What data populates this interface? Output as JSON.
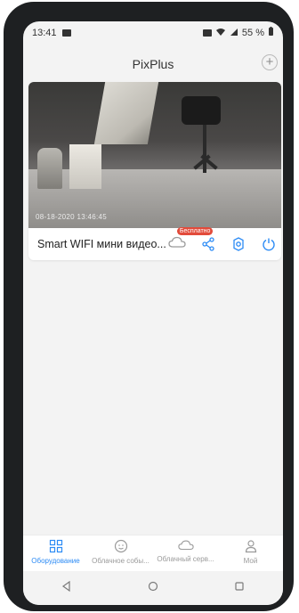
{
  "status_bar": {
    "time": "13:41",
    "battery": "55 %",
    "icons": [
      "video-camera-icon",
      "nfc-icon",
      "wifi-icon",
      "signal-icon",
      "battery-icon"
    ]
  },
  "header": {
    "title": "PixPlus",
    "add_label": "+"
  },
  "device_card": {
    "camera_timestamp": "08-18-2020 13:46:45",
    "device_name": "Smart WIFI мини видео...",
    "cloud_badge": "Бесплатно",
    "action_icons": [
      "cloud-icon",
      "share-icon",
      "settings-icon",
      "power-icon"
    ]
  },
  "bottom_nav": {
    "items": [
      {
        "label": "Оборудование",
        "icon": "grid-icon",
        "active": true
      },
      {
        "label": "Облачное собы...",
        "icon": "smile-icon",
        "active": false
      },
      {
        "label": "Облачный серв...",
        "icon": "cloud-icon",
        "active": false
      },
      {
        "label": "Мой",
        "icon": "user-icon",
        "active": false
      }
    ]
  },
  "system_nav": {
    "icons": [
      "back-icon",
      "home-icon",
      "recents-icon"
    ]
  },
  "colors": {
    "accent": "#2c8bf5",
    "badge": "#e24b3b",
    "background": "#f3f3f3"
  }
}
